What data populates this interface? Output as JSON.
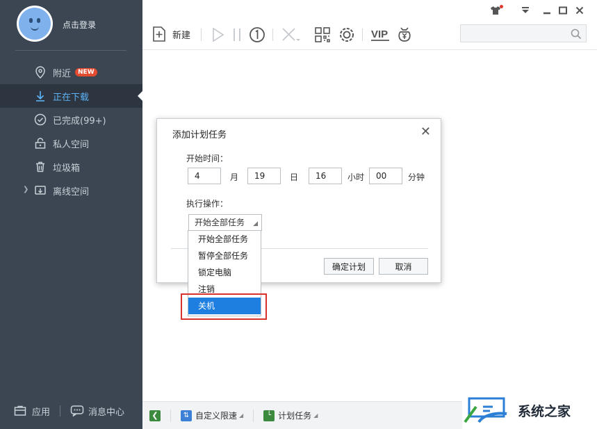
{
  "user": {
    "login_label": "点击登录"
  },
  "sidebar": {
    "items": [
      {
        "label": "附近",
        "badge": "NEW",
        "icon": "location-pin-icon"
      },
      {
        "label": "正在下载",
        "icon": "download-arrow-icon",
        "active": true
      },
      {
        "label": "已完成(99+)",
        "icon": "check-circle-icon"
      },
      {
        "label": "私人空间",
        "icon": "lock-icon"
      },
      {
        "label": "垃圾箱",
        "icon": "trash-icon"
      },
      {
        "label": "离线空间",
        "icon": "cloud-download-icon",
        "expandable": true
      }
    ],
    "bottom": [
      {
        "label": "应用",
        "icon": "app-box-icon"
      },
      {
        "label": "消息中心",
        "icon": "message-bubble-icon"
      }
    ]
  },
  "toolbar": {
    "new_label": "新建",
    "vip_label": "VIP",
    "search_placeholder": ""
  },
  "statusbar": {
    "speed_label": "自定义限速",
    "schedule_label": "计划任务"
  },
  "dialog": {
    "title": "添加计划任务",
    "start_time_label": "开始时间：",
    "month_value": "4",
    "month_unit": "月",
    "day_value": "19",
    "day_unit": "日",
    "hour_value": "16",
    "hour_unit": "小时",
    "minute_value": "00",
    "minute_unit": "分钟",
    "action_label": "执行操作：",
    "selected_action": "开始全部任务",
    "confirm_label": "确定计划",
    "cancel_label": "取消",
    "options": [
      "开始全部任务",
      "暂停全部任务",
      "锁定电脑",
      "注销",
      "关机"
    ],
    "highlighted_option": "关机"
  },
  "watermark": {
    "text": "系统之家"
  },
  "colors": {
    "sidebar_bg": "#3b4652",
    "active_text": "#5eb2f5",
    "selected_option_bg": "#1e7fe0",
    "highlight_border": "#d9312b",
    "new_badge": "#e24b2f"
  }
}
